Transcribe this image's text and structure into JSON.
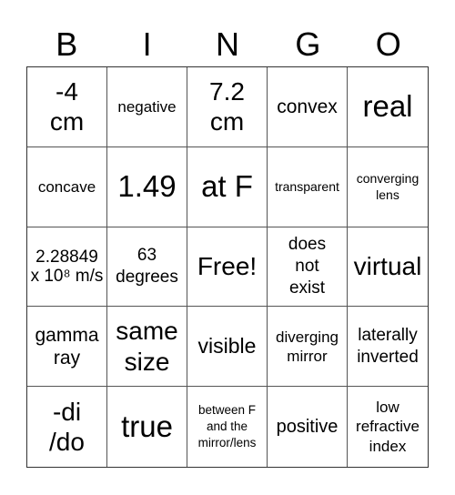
{
  "header": {
    "letters": [
      "B",
      "I",
      "N",
      "G",
      "O"
    ]
  },
  "cells": [
    [
      "-4 cm",
      "negative",
      "7.2 cm",
      "convex",
      "real"
    ],
    [
      "concave",
      "1.49",
      "at F",
      "transparent",
      "converging lens"
    ],
    [
      "2.28849 x 10⁸ m/s",
      "63 degrees",
      "Free!",
      "does not exist",
      "virtual"
    ],
    [
      "gamma ray",
      "same size",
      "visible",
      "diverging mirror",
      "laterally inverted"
    ],
    [
      "-di /do",
      "true",
      "between F and the mirror/lens",
      "positive",
      "low refractive index"
    ]
  ]
}
